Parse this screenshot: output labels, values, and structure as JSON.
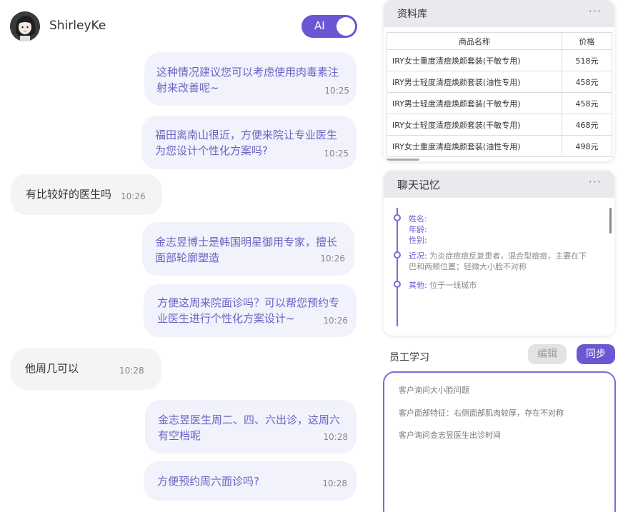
{
  "header": {
    "username": "ShirleyKe",
    "ai_label": "AI",
    "ai_enabled": true
  },
  "messages": [
    {
      "side": "out",
      "text": "这种情况建议您可以考虑使用肉毒素注射来改善呢~",
      "time": "10:25"
    },
    {
      "side": "out",
      "text": "福田离南山很近，方便来院让专业医生为您设计个性化方案吗?",
      "time": "10:25"
    },
    {
      "side": "in",
      "text": "有比较好的医生吗",
      "time": "10:26"
    },
    {
      "side": "out",
      "text": "金志昱博士是韩国明星御用专家，擅长面部轮廓塑造",
      "time": "10:26"
    },
    {
      "side": "out",
      "text": "方便这周来院面诊吗？可以帮您预约专业医生进行个性化方案设计~",
      "time": "10:26"
    },
    {
      "side": "in",
      "text": "他周几可以",
      "time": "10:28"
    },
    {
      "side": "out",
      "text": "金志昱医生周二、四、六出诊，这周六有空档呢",
      "time": "10:28"
    },
    {
      "side": "out",
      "text": "方便预约周六面诊吗?",
      "time": "10:28"
    }
  ],
  "library": {
    "title": "资料库",
    "more": "···",
    "columns": [
      "商品名称",
      "价格"
    ],
    "rows": [
      [
        "IRY女士重度清痘焕颜套装(干敏专用)",
        "518元"
      ],
      [
        "IRY男士轻度清痘焕颜套装(油性专用)",
        "458元"
      ],
      [
        "IRY男士轻度清痘焕颜套装(干敏专用)",
        "458元"
      ],
      [
        "IRY女士轻度清痘焕颜套装(干敏专用)",
        "468元"
      ],
      [
        "IRY女士重度清痘焕颜套装(油性专用)",
        "498元"
      ]
    ]
  },
  "memory": {
    "title": "聊天记忆",
    "more": "···",
    "name_label": "姓名:",
    "age_label": "年龄:",
    "gender_label": "性别:",
    "recent_label": "近况:",
    "recent_text": "为炎症痘痘反复患者，混合型痘痘，主要在下巴和两颊位置；轻微大小脸不对称",
    "other_label": "其他:",
    "other_text": "位于一线城市"
  },
  "staff": {
    "title": "员工学习",
    "edit_label": "编辑",
    "sync_label": "同步",
    "items": [
      "客户询问大小脸问题",
      "客户面部特征：右侧面部肌肉较厚，存在不对称",
      "客户询问金志昱医生出诊时间"
    ]
  },
  "colors": {
    "accent": "#6a57d3",
    "bubble_out_bg": "#f1f2fc",
    "bubble_out_text": "#6a63c2",
    "bubble_in_bg": "#f4f4f4"
  }
}
